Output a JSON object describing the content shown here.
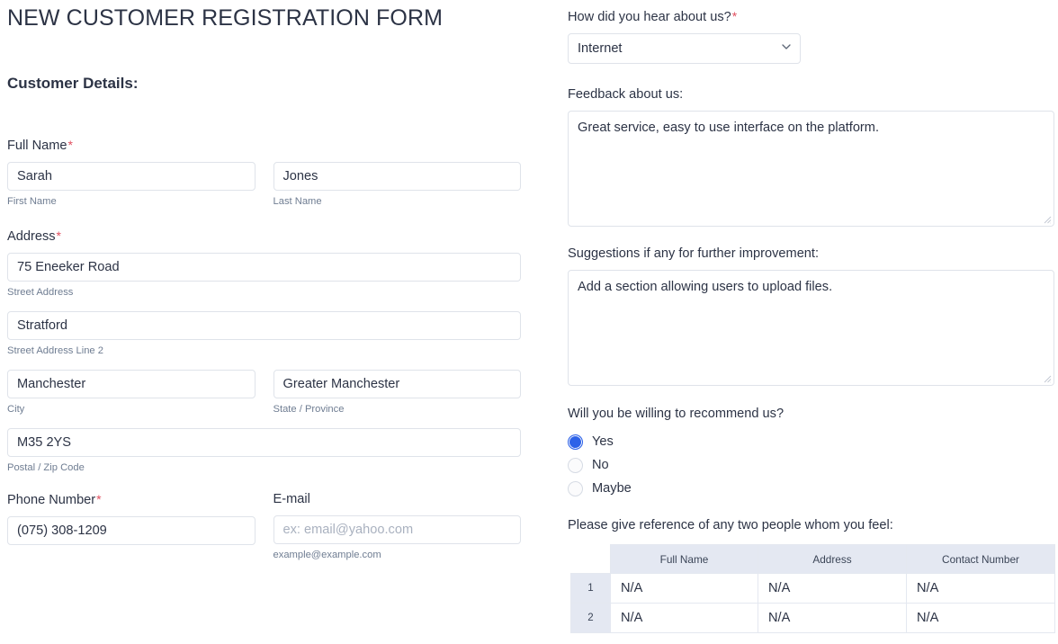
{
  "form": {
    "title": "NEW CUSTOMER REGISTRATION FORM",
    "section_heading": "Customer Details:"
  },
  "left": {
    "full_name": {
      "label": "Full Name",
      "required": "*",
      "first": {
        "value": "Sarah",
        "sublabel": "First Name"
      },
      "last": {
        "value": "Jones",
        "sublabel": "Last Name"
      }
    },
    "address": {
      "label": "Address",
      "required": "*",
      "street": {
        "value": "75 Eneeker Road",
        "sublabel": "Street Address"
      },
      "street2": {
        "value": "Stratford",
        "sublabel": "Street Address Line 2"
      },
      "city": {
        "value": "Manchester",
        "sublabel": "City"
      },
      "state": {
        "value": "Greater Manchester",
        "sublabel": "State / Province"
      },
      "postal": {
        "value": "M35 2YS",
        "sublabel": "Postal / Zip Code"
      }
    },
    "phone": {
      "label": "Phone Number",
      "required": "*",
      "value": "(075) 308-1209"
    },
    "email": {
      "label": "E-mail",
      "value": "",
      "placeholder": "ex: email@yahoo.com",
      "sublabel": "example@example.com"
    }
  },
  "right": {
    "hear_about": {
      "label": "How did you hear about us?",
      "required": "*",
      "selected": "Internet",
      "options": [
        "Internet"
      ]
    },
    "feedback": {
      "label": "Feedback about us:",
      "value": "Great service, easy to use interface on the platform."
    },
    "suggestions": {
      "label": "Suggestions if any for further improvement:",
      "value": "Add a section allowing users to upload files."
    },
    "recommend": {
      "label": "Will you be willing to recommend us?",
      "options": [
        {
          "label": "Yes",
          "selected": true
        },
        {
          "label": "No",
          "selected": false
        },
        {
          "label": "Maybe",
          "selected": false
        }
      ]
    },
    "references": {
      "label": "Please give reference of any two people whom you feel:",
      "columns": [
        "Full Name",
        "Address",
        "Contact Number"
      ],
      "rows": [
        {
          "index": "1",
          "cells": [
            "N/A",
            "N/A",
            "N/A"
          ]
        },
        {
          "index": "2",
          "cells": [
            "N/A",
            "N/A",
            "N/A"
          ]
        }
      ]
    }
  },
  "colors": {
    "required_asterisk": "#e04f5f",
    "radio_selected": "#2d62e8",
    "table_header_bg": "#e4e8f2",
    "input_border": "#dfe3ea",
    "text": "#2c3345",
    "sublabel_text": "#6f7d92"
  }
}
